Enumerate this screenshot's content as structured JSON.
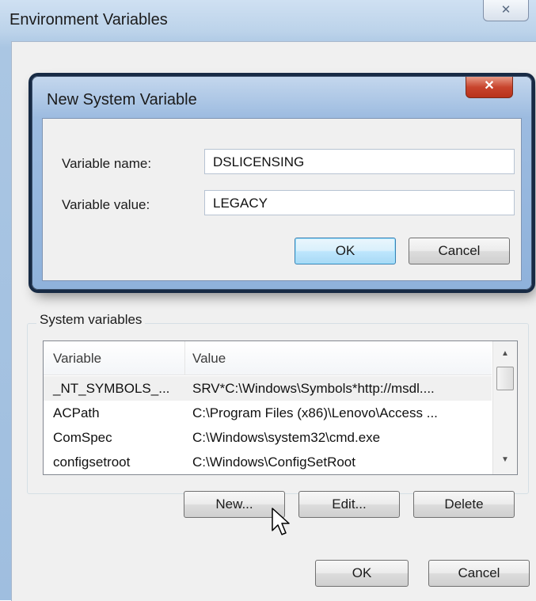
{
  "outer_window": {
    "title": "Environment Variables",
    "close_label": "✕"
  },
  "dialog": {
    "title": "New System Variable",
    "close_label": "✕",
    "name_label": "Variable name:",
    "name_value": "DSLICENSING",
    "value_label": "Variable value:",
    "value_value": "LEGACY",
    "ok_label": "OK",
    "cancel_label": "Cancel"
  },
  "system_variables": {
    "group_label": "System variables",
    "columns": [
      "Variable",
      "Value"
    ],
    "rows": [
      {
        "variable": "_NT_SYMBOLS_...",
        "value": "SRV*C:\\Windows\\Symbols*http://msdl...."
      },
      {
        "variable": "ACPath",
        "value": "C:\\Program Files (x86)\\Lenovo\\Access ..."
      },
      {
        "variable": "ComSpec",
        "value": "C:\\Windows\\system32\\cmd.exe"
      },
      {
        "variable": "configsetroot",
        "value": "C:\\Windows\\ConfigSetRoot"
      }
    ],
    "new_label": "New...",
    "edit_label": "Edit...",
    "delete_label": "Delete"
  },
  "footer": {
    "ok_label": "OK",
    "cancel_label": "Cancel"
  },
  "icons": {
    "scroll_up": "▲",
    "scroll_down": "▼"
  }
}
